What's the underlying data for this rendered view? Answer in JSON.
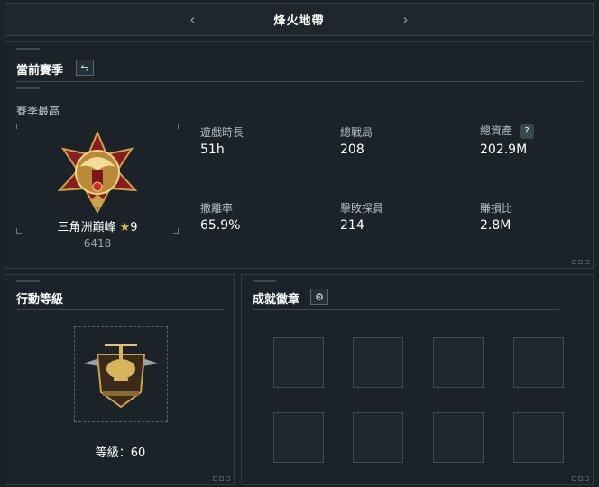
{
  "header": {
    "title": "烽火地帶",
    "prev_icon": "chevron-left-icon",
    "next_icon": "chevron-right-icon"
  },
  "season": {
    "title": "當前賽季",
    "switch_icon": "swap-icon",
    "best_label": "賽季最高",
    "rank_name": "三角洲巔峰",
    "rank_stars": "9",
    "rank_points": "6418",
    "stats": [
      {
        "label": "遊戲時長",
        "value": "51h"
      },
      {
        "label": "總戰局",
        "value": "208"
      },
      {
        "label": "總資產",
        "value": "202.9M",
        "has_help": true
      },
      {
        "label": "撤離率",
        "value": "65.9%"
      },
      {
        "label": "擊敗探員",
        "value": "214"
      },
      {
        "label": "賺損比",
        "value": "2.8M"
      }
    ]
  },
  "action": {
    "title": "行動等級",
    "level_label": "等級：60"
  },
  "achievements": {
    "title": "成就徽章",
    "settings_icon": "gear-icon",
    "slots": 8
  },
  "colors": {
    "background": "#1a2127",
    "panel": "#1b2328",
    "gold": "#c9a24a",
    "red": "#9a1e22"
  }
}
